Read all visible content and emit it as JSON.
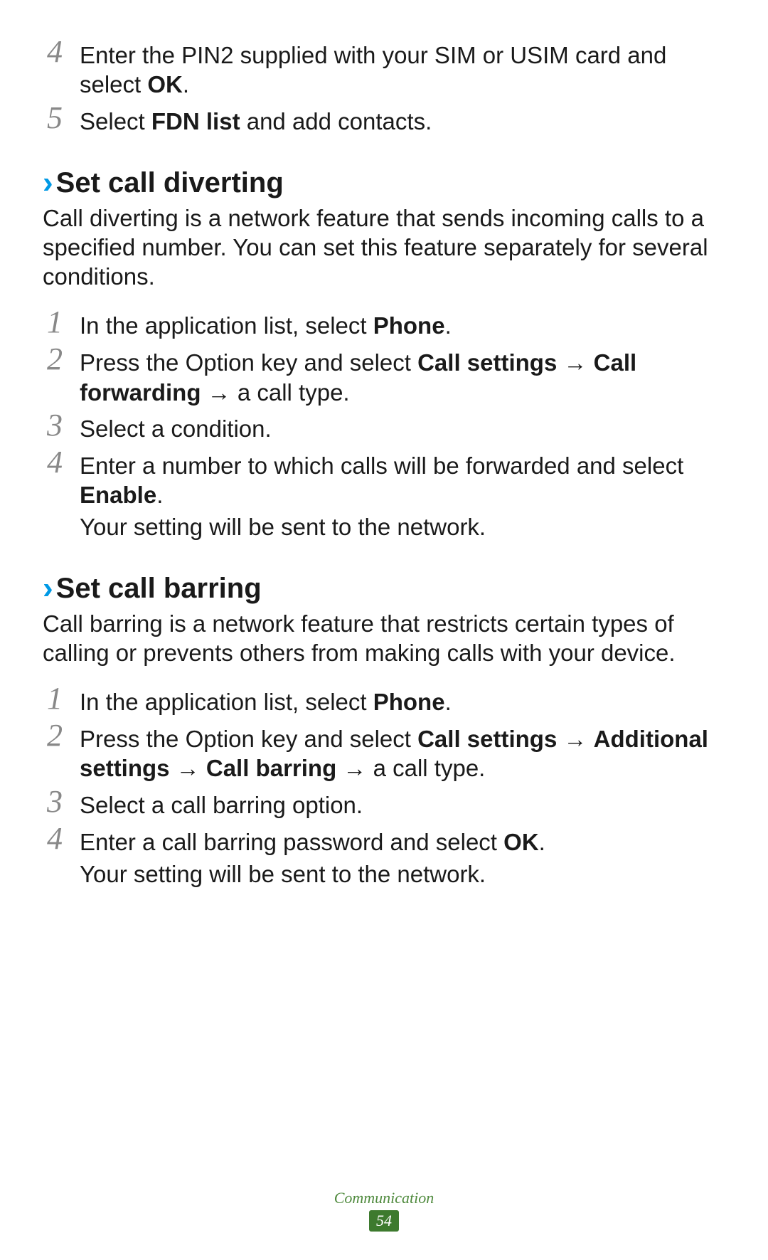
{
  "intro_steps": [
    {
      "num": "4",
      "segments": [
        {
          "t": "Enter the PIN2 supplied with your SIM or USIM card and select ",
          "b": false
        },
        {
          "t": "OK",
          "b": true
        },
        {
          "t": ".",
          "b": false
        }
      ]
    },
    {
      "num": "5",
      "segments": [
        {
          "t": "Select ",
          "b": false
        },
        {
          "t": "FDN list",
          "b": true
        },
        {
          "t": " and add contacts.",
          "b": false
        }
      ]
    }
  ],
  "section1": {
    "chevron": "›",
    "title": "Set call diverting",
    "desc": "Call diverting is a network feature that sends incoming calls to a specified number. You can set this feature separately for several conditions.",
    "steps": [
      {
        "num": "1",
        "segments": [
          {
            "t": "In the application list, select ",
            "b": false
          },
          {
            "t": "Phone",
            "b": true
          },
          {
            "t": ".",
            "b": false
          }
        ]
      },
      {
        "num": "2",
        "segments": [
          {
            "t": "Press the Option key and select ",
            "b": false
          },
          {
            "t": "Call settings",
            "b": true
          },
          {
            "t": " → ",
            "b": false
          },
          {
            "t": "Call forwarding",
            "b": true
          },
          {
            "t": " → a call type.",
            "b": false
          }
        ]
      },
      {
        "num": "3",
        "segments": [
          {
            "t": "Select a condition.",
            "b": false
          }
        ]
      },
      {
        "num": "4",
        "segments": [
          {
            "t": "Enter a number to which calls will be forwarded and select ",
            "b": false
          },
          {
            "t": "Enable",
            "b": true
          },
          {
            "t": ".",
            "b": false
          }
        ],
        "after": "Your setting will be sent to the network."
      }
    ]
  },
  "section2": {
    "chevron": "›",
    "title": "Set call barring",
    "desc": "Call barring is a network feature that restricts certain types of calling or prevents others from making calls with your device.",
    "steps": [
      {
        "num": "1",
        "segments": [
          {
            "t": "In the application list, select ",
            "b": false
          },
          {
            "t": "Phone",
            "b": true
          },
          {
            "t": ".",
            "b": false
          }
        ]
      },
      {
        "num": "2",
        "segments": [
          {
            "t": "Press the Option key and select ",
            "b": false
          },
          {
            "t": "Call settings",
            "b": true
          },
          {
            "t": " → ",
            "b": false
          },
          {
            "t": "Additional settings",
            "b": true
          },
          {
            "t": " → ",
            "b": false
          },
          {
            "t": "Call barring",
            "b": true
          },
          {
            "t": " → a call type.",
            "b": false
          }
        ]
      },
      {
        "num": "3",
        "segments": [
          {
            "t": "Select a call barring option.",
            "b": false
          }
        ]
      },
      {
        "num": "4",
        "segments": [
          {
            "t": "Enter a call barring password and select ",
            "b": false
          },
          {
            "t": "OK",
            "b": true
          },
          {
            "t": ".",
            "b": false
          }
        ],
        "after": "Your setting will be sent to the network."
      }
    ]
  },
  "footer": {
    "section": "Communication",
    "page": "54"
  }
}
